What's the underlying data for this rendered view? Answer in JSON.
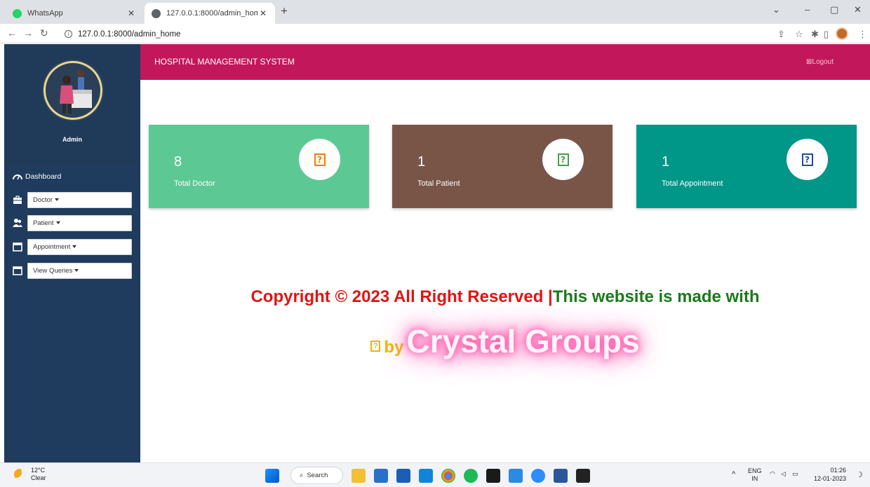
{
  "browser": {
    "tabs": [
      {
        "title": "WhatsApp",
        "active": false
      },
      {
        "title": "127.0.0.1:8000/admin_home",
        "active": true
      }
    ],
    "url": "127.0.0.1:8000/admin_home"
  },
  "sidebar": {
    "admin_name": "Admin",
    "dashboard_label": "Dashboard",
    "menu": [
      {
        "label": "Doctor",
        "icon": "briefcase-icon"
      },
      {
        "label": "Patient",
        "icon": "users-icon"
      },
      {
        "label": "Appointment",
        "icon": "calendar-icon"
      },
      {
        "label": "View Queries",
        "icon": "calendar-icon"
      }
    ]
  },
  "header": {
    "title": "HOSPITAL MANAGEMENT SYSTEM",
    "logout_label": "Logout"
  },
  "cards": [
    {
      "value": "8",
      "label": "Total Doctor",
      "color": "#5cc995",
      "icon_color": "#f57c00"
    },
    {
      "value": "1",
      "label": "Total Patient",
      "color": "#795548",
      "icon_color": "#43a047"
    },
    {
      "value": "1",
      "label": "Total Appointment",
      "color": "#009688",
      "icon_color": "#1f4f8c"
    }
  ],
  "footer": {
    "copyright": "Copyright © 2023 All Right Reserved",
    "separator": "|",
    "made_with": "This website is made with",
    "by": "by",
    "company": "Crystal Groups"
  },
  "taskbar": {
    "temperature": "12°C",
    "weather": "Clear",
    "search_label": "Search",
    "lang_top": "ENG",
    "lang_bottom": "IN",
    "time": "01:26",
    "date": "12-01-2023"
  }
}
